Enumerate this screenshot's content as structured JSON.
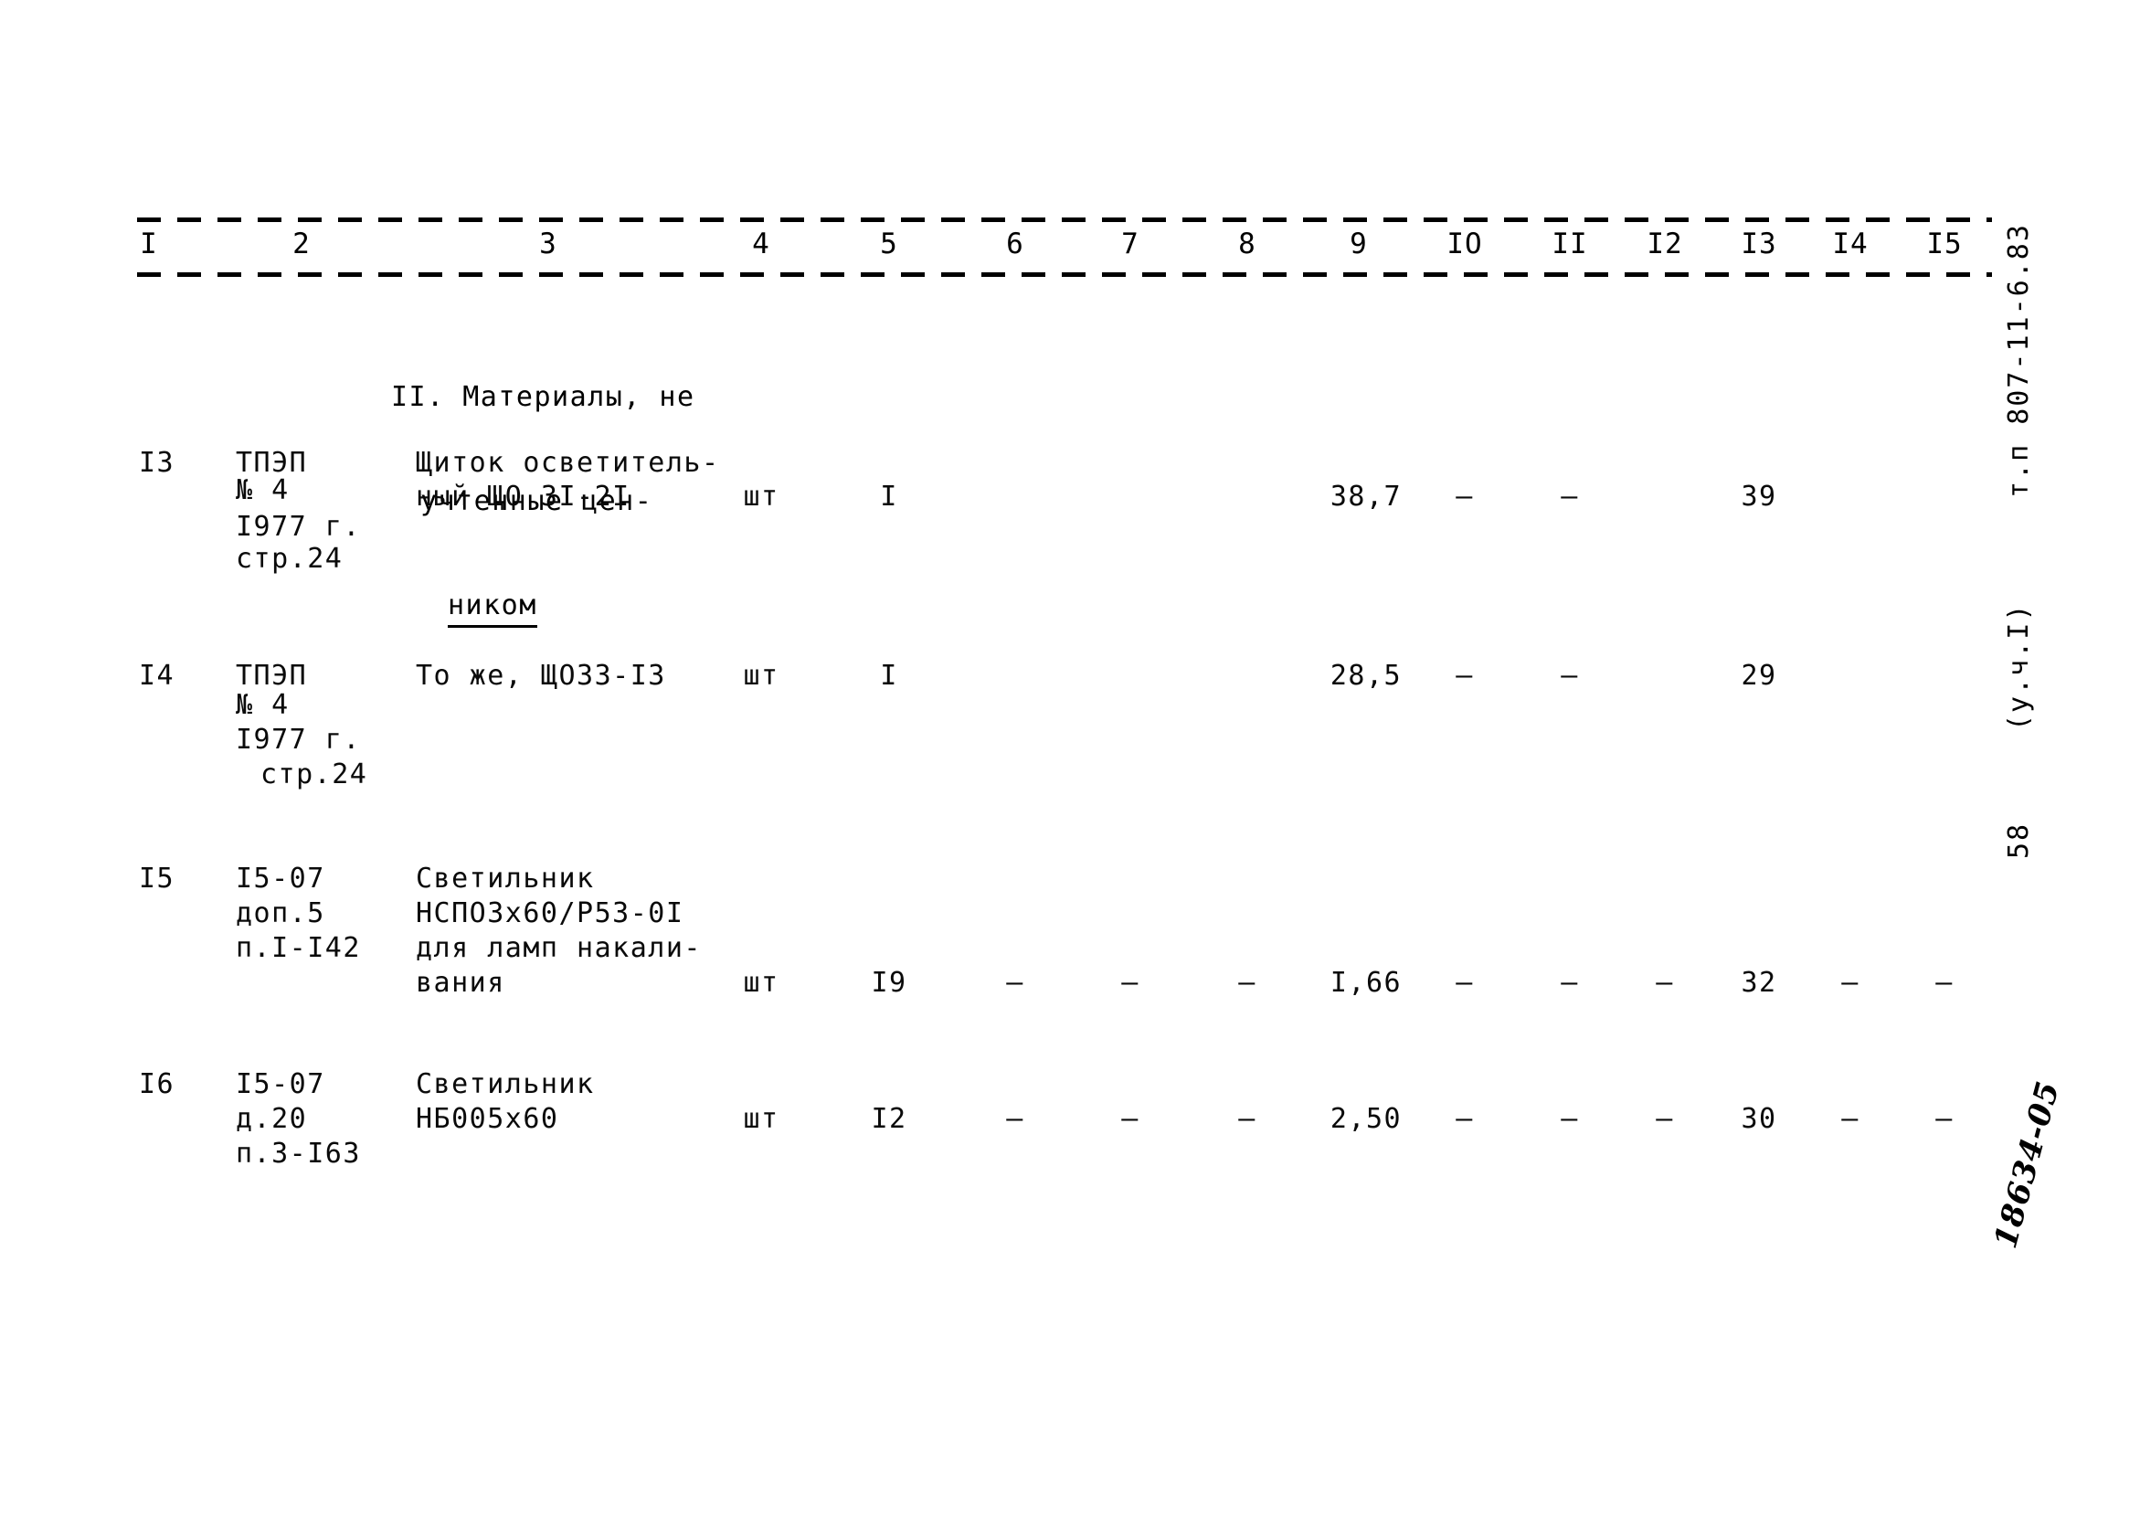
{
  "document": {
    "table_title": "II. Материалы, не учтенные ценником",
    "title_lines": [
      "II. Материалы, не",
      "учтенные цен-",
      "ником"
    ],
    "column_numbers": [
      "I",
      "2",
      "3",
      "4",
      "5",
      "6",
      "7",
      "8",
      "9",
      "IO",
      "II",
      "I2",
      "I3",
      "I4",
      "I5"
    ]
  },
  "margin_notes": {
    "code": "т.п 807-11-6.83",
    "part": "(у.ч.I)",
    "page_number": "58",
    "handwritten_id": "18634-05"
  },
  "rows": [
    {
      "num": "I3",
      "source_lines": [
        "ТПЭП",
        "№ 4",
        "I977 г.",
        "стр.24"
      ],
      "name_lines": [
        "Щиток осветитель-",
        "ный ЩО 3I-2I"
      ],
      "unit": "шт",
      "qty": "I",
      "c6": "",
      "c7": "",
      "c8": "",
      "c9": "38,7",
      "c10": "—",
      "c11": "—",
      "c12": "",
      "c13": "39",
      "c14": "",
      "c15": ""
    },
    {
      "num": "I4",
      "source_lines": [
        "ТПЭП",
        "№ 4",
        "I977 г.",
        "стр.24"
      ],
      "name_lines": [
        "То же, ЩО33-I3"
      ],
      "unit": "шт",
      "qty": "I",
      "c6": "",
      "c7": "",
      "c8": "",
      "c9": "28,5",
      "c10": "—",
      "c11": "—",
      "c12": "",
      "c13": "29",
      "c14": "",
      "c15": ""
    },
    {
      "num": "I5",
      "source_lines": [
        "I5-07",
        "доп.5",
        "п.I-I42"
      ],
      "name_lines": [
        "Светильник",
        "НСПО3х60/Р53-0I",
        "для ламп накали-",
        "вания"
      ],
      "unit": "шт",
      "qty": "I9",
      "c6": "—",
      "c7": "—",
      "c8": "—",
      "c9": "I,66",
      "c10": "—",
      "c11": "—",
      "c12": "—",
      "c13": "32",
      "c14": "—",
      "c15": "—"
    },
    {
      "num": "I6",
      "source_lines": [
        "I5-07",
        "д.20",
        "п.3-I63"
      ],
      "name_lines": [
        "Светильник",
        "НБ005х60"
      ],
      "unit": "шт",
      "qty": "I2",
      "c6": "—",
      "c7": "—",
      "c8": "—",
      "c9": "2,50",
      "c10": "—",
      "c11": "—",
      "c12": "—",
      "c13": "30",
      "c14": "—",
      "c15": "—"
    }
  ]
}
